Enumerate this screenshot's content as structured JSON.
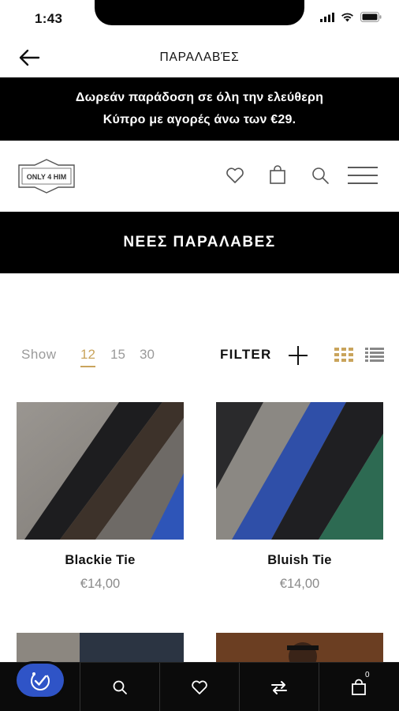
{
  "status_bar": {
    "time": "1:43"
  },
  "nav": {
    "title": "ΠΑΡΑΛΑΒΈΣ"
  },
  "promo": {
    "line1": "Δωρεάν παράδοση σε όλη την ελεύθερη",
    "line2": "Κύπρο με αγορές άνω των €29."
  },
  "logo": {
    "text": "ONLY 4 HIM"
  },
  "section": {
    "title": "ΝΕΕΣ ΠΑΡΑΛΑΒΕΣ"
  },
  "toolbar": {
    "show_label": "Show",
    "per_page": [
      "12",
      "15",
      "30"
    ],
    "per_page_selected": "12",
    "filter_label": "FILTER"
  },
  "products": [
    {
      "name": "Blackie Tie",
      "price": "€14,00"
    },
    {
      "name": "Bluish Tie",
      "price": "€14,00"
    }
  ],
  "bottom_bar": {
    "cart_count": "0",
    "icons": [
      "search-icon",
      "heart-icon",
      "compare-icon",
      "cart-icon"
    ]
  },
  "colors": {
    "accent": "#c9a45c",
    "banner_bg": "#000000",
    "bottom_bar_bg": "#0b0b0b",
    "badge_blue": "#2f54c7",
    "muted_text": "#9a9a9a"
  }
}
